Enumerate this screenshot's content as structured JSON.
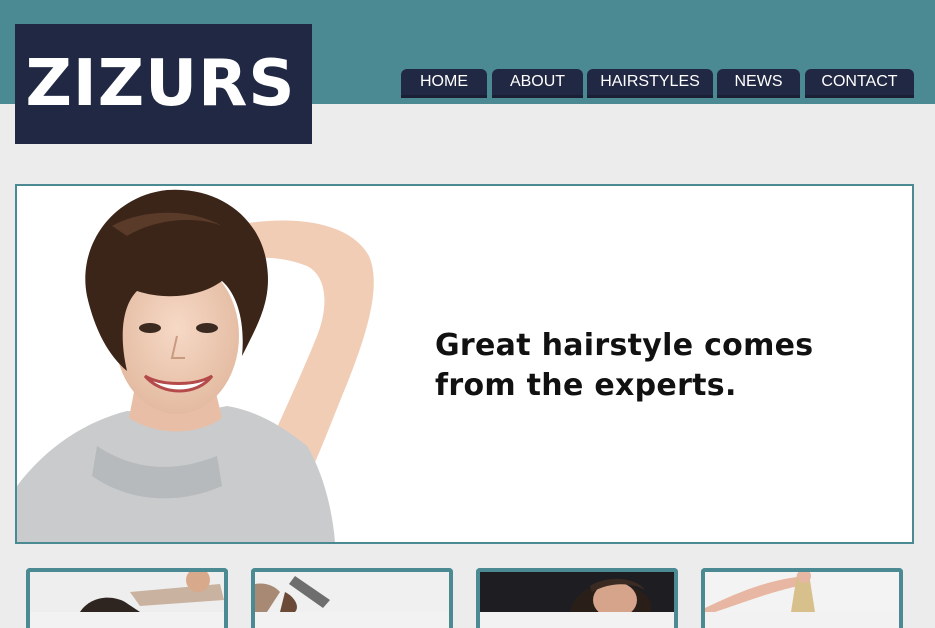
{
  "header": {
    "logo_text": "ZIZURS",
    "band_color": "#4b8a92",
    "logo_bg_color": "#212843"
  },
  "nav": {
    "items": [
      {
        "label": "HOME"
      },
      {
        "label": "ABOUT"
      },
      {
        "label": "HAIRSTYLES"
      },
      {
        "label": "NEWS"
      },
      {
        "label": "CONTACT"
      }
    ]
  },
  "hero": {
    "headline_line1": "Great hairstyle comes",
    "headline_line2": "from the experts.",
    "image": "smiling-woman-short-hair-photo"
  },
  "thumbnails": [
    {
      "image": "hair-cutting-photo"
    },
    {
      "image": "hair-trimmer-photo"
    },
    {
      "image": "stylist-at-work-photo"
    },
    {
      "image": "long-hair-styling-photo"
    }
  ]
}
